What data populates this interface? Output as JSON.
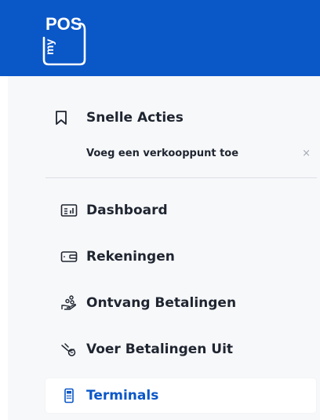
{
  "brand": {
    "logo_text_top": "POS",
    "logo_text_side": "my",
    "header_color": "#0a57c8"
  },
  "quick_actions": {
    "title": "Snelle Acties",
    "icon": "bookmark-icon",
    "items": [
      {
        "label": "Voeg een verkooppunt toe",
        "close": "×"
      }
    ]
  },
  "nav": {
    "items": [
      {
        "label": "Dashboard",
        "icon": "dashboard-icon",
        "active": false
      },
      {
        "label": "Rekeningen",
        "icon": "wallet-icon",
        "active": false
      },
      {
        "label": "Ontvang Betalingen",
        "icon": "receive-payment-icon",
        "active": false
      },
      {
        "label": "Voer Betalingen Uit",
        "icon": "send-payment-icon",
        "active": false
      },
      {
        "label": "Terminals",
        "icon": "terminal-icon",
        "active": true
      }
    ],
    "active_color": "#0a57c8"
  }
}
